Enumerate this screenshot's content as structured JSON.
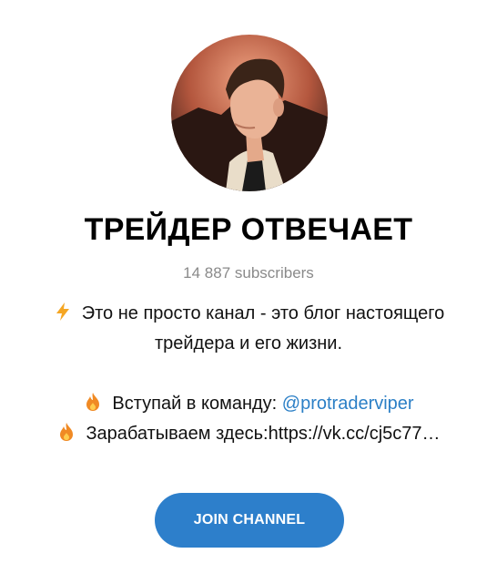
{
  "channel": {
    "title": "ТРЕЙДЕР ОТВЕЧАЕТ",
    "subscribers": "14 887 subscribers"
  },
  "description": {
    "line1": "Это не просто канал - это блог настоящего",
    "line2": "трейдера и его жизни.",
    "line3_text": "Вступай в команду: ",
    "line3_mention": "@protraderviper",
    "line4": "Зарабатываем здесь:https://vk.cc/cj5c77…",
    "icons": [
      "lightning-icon",
      "fire-icon",
      "fire-icon"
    ]
  },
  "join_button": {
    "label": "JOIN CHANNEL"
  },
  "colors": {
    "accent": "#2d7fcb",
    "mention": "#2b7fc6",
    "muted": "#8a8a8a"
  }
}
